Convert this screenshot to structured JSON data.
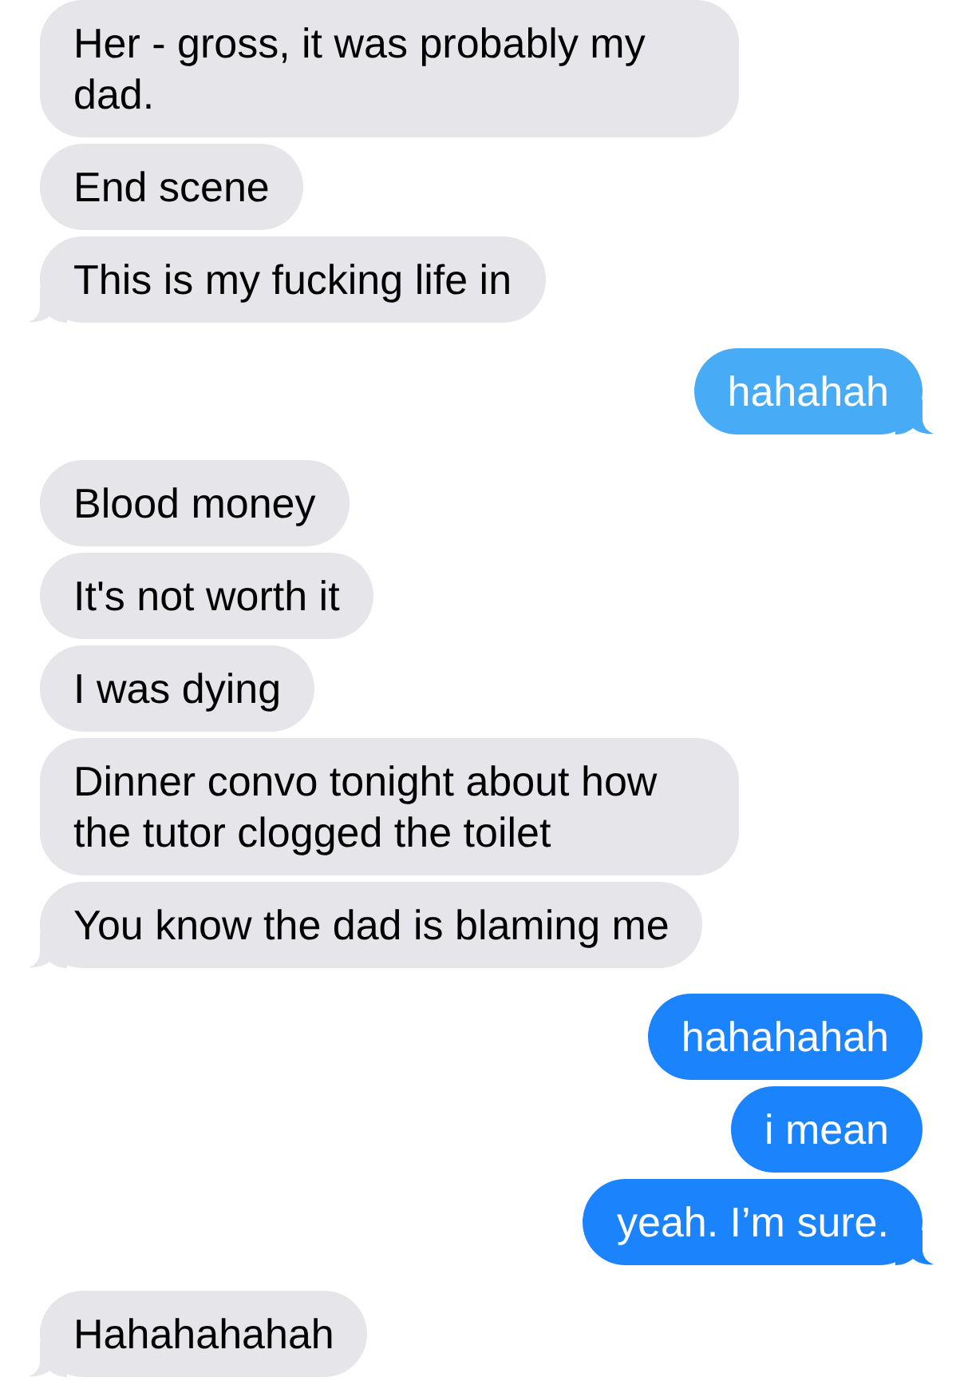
{
  "messages": [
    {
      "kind": "incoming",
      "text": "Her - gross, it was probably my dad.",
      "tail": false,
      "color": "#e5e5ea"
    },
    {
      "kind": "incoming",
      "text": "End scene",
      "tail": false,
      "color": "#e5e5ea"
    },
    {
      "kind": "incoming",
      "text": "This is my fucking life in",
      "tail": true,
      "color": "#e5e5ea"
    },
    {
      "kind": "outgoing",
      "text": "hahahah",
      "tail": true,
      "color": "#47abf6"
    },
    {
      "kind": "incoming",
      "text": "Blood money",
      "tail": false,
      "color": "#e5e5ea"
    },
    {
      "kind": "incoming",
      "text": "It's not worth it",
      "tail": false,
      "color": "#e5e5ea"
    },
    {
      "kind": "incoming",
      "text": "I was dying",
      "tail": false,
      "color": "#e5e5ea"
    },
    {
      "kind": "incoming",
      "text": "Dinner convo tonight about how the tutor clogged the toilet",
      "tail": false,
      "color": "#e5e5ea"
    },
    {
      "kind": "incoming",
      "text": "You know the dad is blaming me",
      "tail": true,
      "color": "#e5e5ea"
    },
    {
      "kind": "outgoing",
      "text": "hahahahah",
      "tail": false,
      "color": "#1b83fb"
    },
    {
      "kind": "outgoing",
      "text": "i mean",
      "tail": false,
      "color": "#1b83fb"
    },
    {
      "kind": "outgoing",
      "text": "yeah. I’m sure.",
      "tail": true,
      "color": "#1b83fb"
    },
    {
      "kind": "incoming",
      "text": "Hahahahahah",
      "tail": true,
      "color": "#e5e5ea"
    }
  ]
}
